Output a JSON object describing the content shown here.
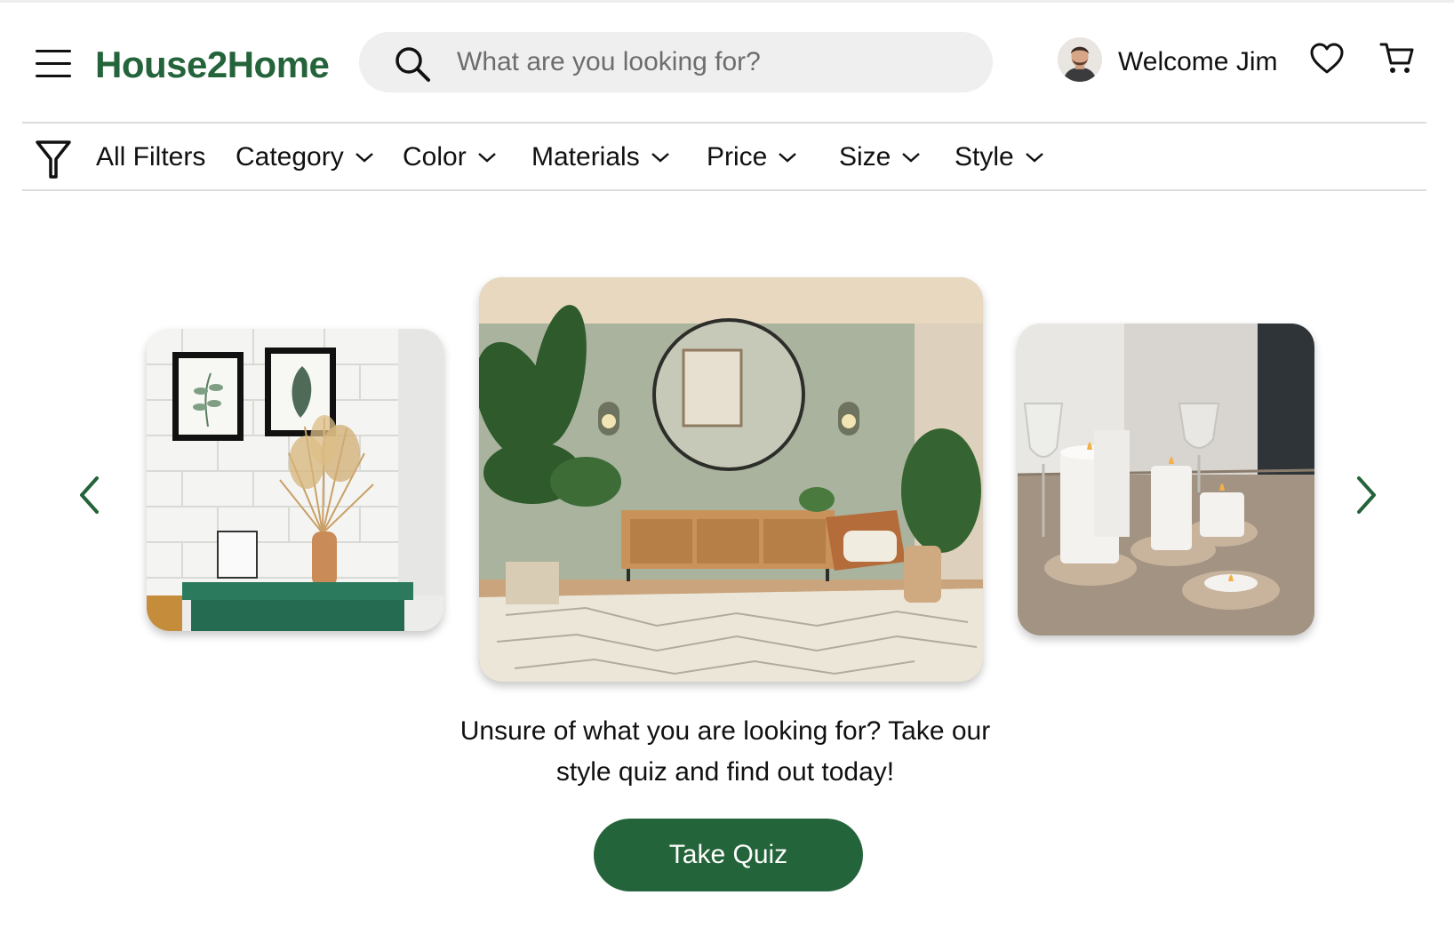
{
  "header": {
    "menu_icon": "hamburger-menu-icon",
    "logo_text": "House2Home",
    "search_placeholder": "What are you looking for?",
    "welcome_text": "Welcome Jim",
    "wishlist_icon": "heart-icon",
    "cart_icon": "shopping-cart-icon"
  },
  "filters": {
    "all_label": "All Filters",
    "items": [
      {
        "label": "Category"
      },
      {
        "label": "Color"
      },
      {
        "label": "Materials"
      },
      {
        "label": "Price"
      },
      {
        "label": "Size"
      },
      {
        "label": "Style"
      }
    ]
  },
  "carousel": {
    "prev_icon": "chevron-left-icon",
    "next_icon": "chevron-right-icon",
    "slides": [
      {
        "subject": "green sideboard with framed botanical prints and pampas grass vase"
      },
      {
        "subject": "sage green living room with round mirror, rattan console and plants"
      },
      {
        "subject": "white pillar candles on wooden holders with wine glasses"
      }
    ]
  },
  "promo": {
    "line1": "Unsure of what you are looking for? Take our",
    "line2": "style quiz and find out today!",
    "button_label": "Take Quiz"
  },
  "colors": {
    "brand_green": "#24643a",
    "search_bg": "#efefef",
    "divider": "#dcdcdc"
  }
}
